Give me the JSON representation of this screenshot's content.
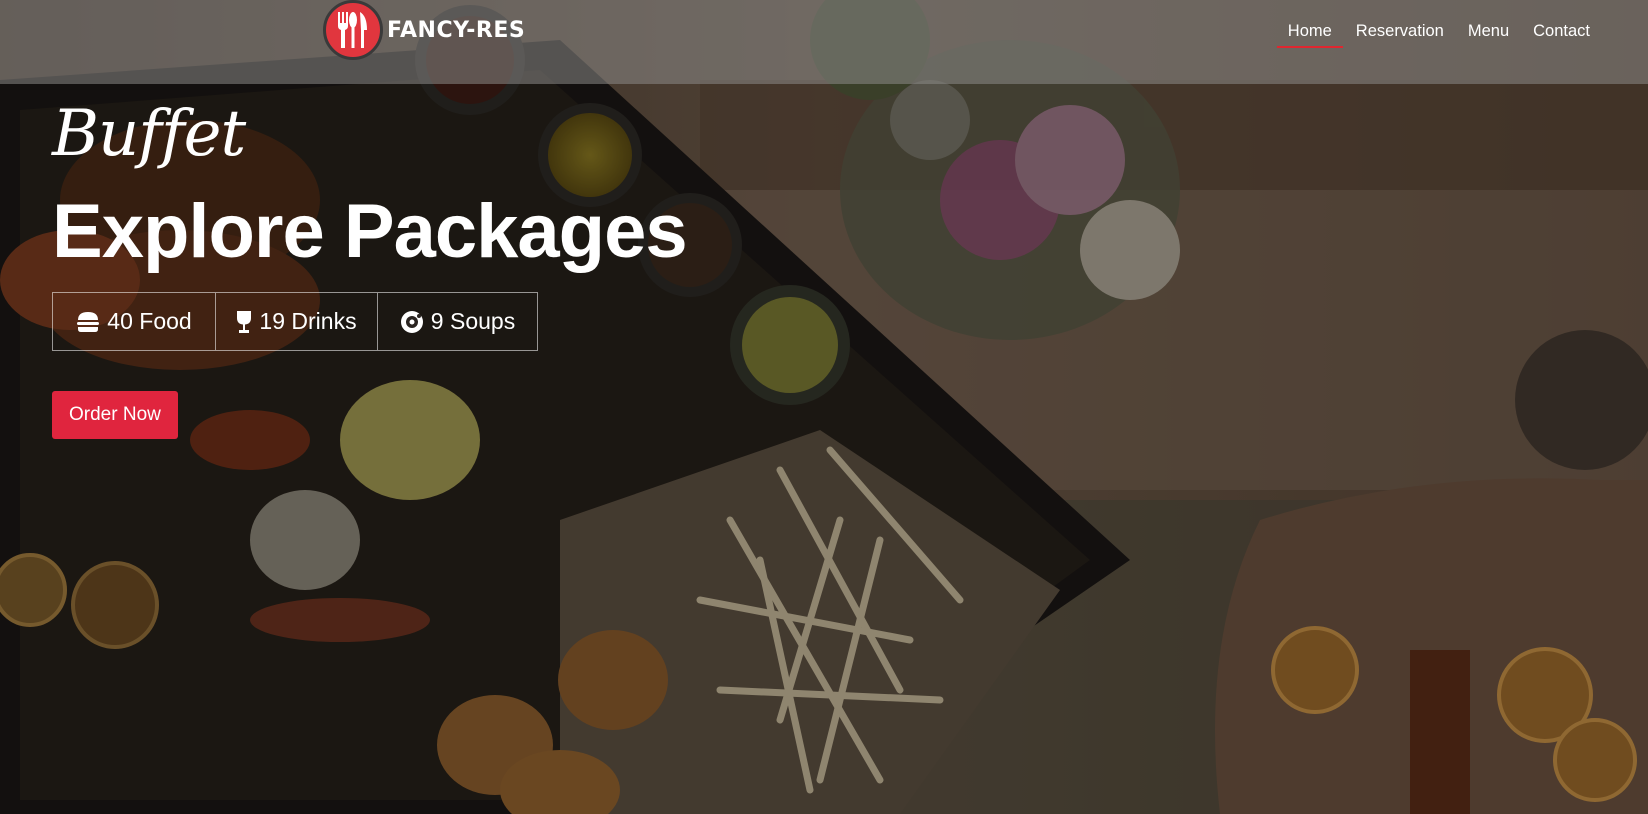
{
  "brand": {
    "name": "FANCY-RES",
    "logo_icon": "fork-knife-icon",
    "logo_color": "#e1363e"
  },
  "nav": {
    "items": [
      {
        "label": "Home",
        "active": true
      },
      {
        "label": "Reservation",
        "active": false
      },
      {
        "label": "Menu",
        "active": false
      },
      {
        "label": "Contact",
        "active": false
      }
    ],
    "active_underline_color": "#e0262f"
  },
  "hero": {
    "script_title": "Buffet",
    "title": "Explore Packages",
    "stats": [
      {
        "icon": "burger-icon",
        "label": "40 Food"
      },
      {
        "icon": "wine-glass-icon",
        "label": "19 Drinks"
      },
      {
        "icon": "soup-bowl-icon",
        "label": "9 Soups"
      }
    ],
    "cta_label": "Order Now",
    "cta_color": "#e0253e"
  }
}
